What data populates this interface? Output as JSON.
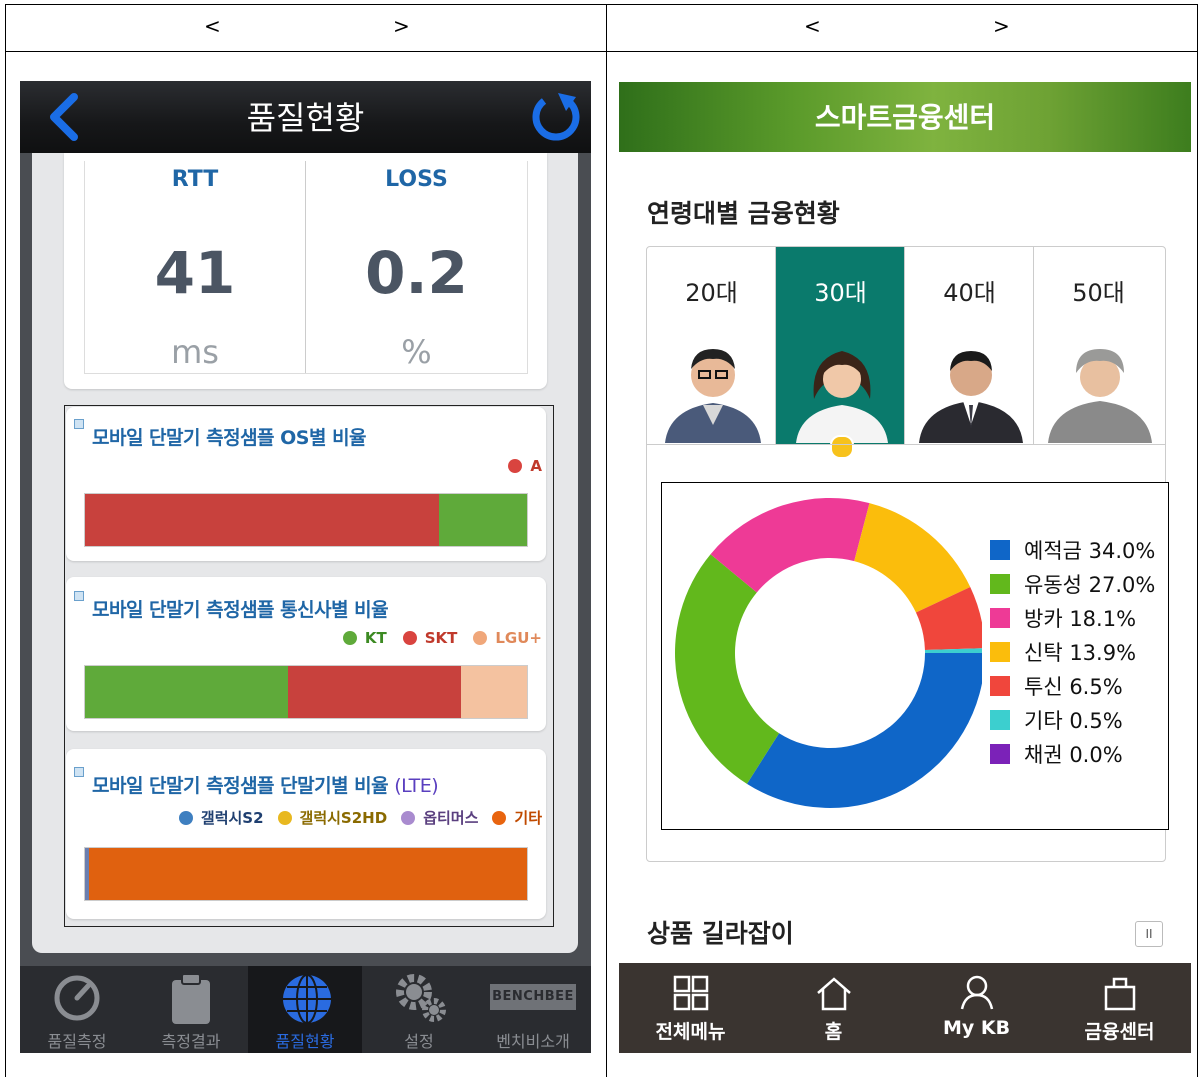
{
  "header": {
    "left": {
      "open": "<",
      "close": ">"
    },
    "right": {
      "open": "<",
      "close": ">"
    }
  },
  "left_app": {
    "title": "품질현황",
    "stats": [
      {
        "label": "RTT",
        "value": "41",
        "unit": "ms"
      },
      {
        "label": "LOSS",
        "value": "0.2",
        "unit": "%"
      }
    ],
    "sections": [
      {
        "title": "모바일 단말기 측정샘플 OS별 비율",
        "legend": [
          {
            "label": "A",
            "color": "#d9443f"
          }
        ],
        "bar": [
          {
            "fraction": 0.8,
            "color": "#c8413d"
          },
          {
            "fraction": 0.2,
            "color": "#5faa3a"
          }
        ]
      },
      {
        "title": "모바일 단말기 측정샘플 통신사별 비율",
        "legend": [
          {
            "label": "KT",
            "color": "#5faa3a"
          },
          {
            "label": "SKT",
            "color": "#d9443f"
          },
          {
            "label": "LGU+",
            "color": "#f0a77a"
          }
        ],
        "bar": [
          {
            "fraction": 0.46,
            "color": "#5faa3a"
          },
          {
            "fraction": 0.39,
            "color": "#c8413d"
          },
          {
            "fraction": 0.15,
            "color": "#f4c2a0"
          }
        ]
      },
      {
        "title": "모바일 단말기 측정샘플 단말기별 비율",
        "title_suffix": "(LTE)",
        "legend": [
          {
            "label": "갤럭시S2",
            "color": "#3e7fc0"
          },
          {
            "label": "갤럭시S2HD",
            "color": "#e8b820"
          },
          {
            "label": "옵티머스",
            "color": "#a98bcf"
          },
          {
            "label": "기타",
            "color": "#e8640f"
          }
        ],
        "bar": [
          {
            "fraction": 0.01,
            "color": "#6b7fb0"
          },
          {
            "fraction": 0.99,
            "color": "#e0610f"
          }
        ]
      }
    ],
    "tabs": [
      {
        "label": "품질측정",
        "icon": "gauge-icon",
        "active": false
      },
      {
        "label": "측정결과",
        "icon": "clipboard-icon",
        "active": false
      },
      {
        "label": "품질현황",
        "icon": "globe-icon",
        "active": true
      },
      {
        "label": "설정",
        "icon": "gear-icon",
        "active": false
      },
      {
        "label": "벤치비소개",
        "icon": "benchbee-logo-icon",
        "active": false
      }
    ],
    "logo_text": "BENCHBEE"
  },
  "right_app": {
    "title": "스마트금융센터",
    "heading": "연령대별 금융현황",
    "age_tabs": [
      {
        "label": "20대",
        "active": false
      },
      {
        "label": "30대",
        "active": true
      },
      {
        "label": "40대",
        "active": false
      },
      {
        "label": "50대",
        "active": false
      }
    ],
    "chart_data": {
      "type": "pie",
      "categories": [
        "예적금",
        "유동성",
        "방카",
        "신탁",
        "투신",
        "기타",
        "채권"
      ],
      "values": [
        34.0,
        27.0,
        18.1,
        13.9,
        6.5,
        0.5,
        0.0
      ],
      "legend_labels": [
        "예적금 34.0%",
        "유동성 27.0%",
        "방카 18.1%",
        "신탁 13.9%",
        "투신 6.5%",
        "기타 0.5%",
        "채권 0.0%"
      ],
      "colors": [
        "#0f66c8",
        "#62b81c",
        "#ee3a96",
        "#fbbd0c",
        "#f0463c",
        "#3ccfcf",
        "#7b22b8"
      ],
      "donut": true,
      "legend_position": "right"
    },
    "section2": "상품 길라잡이",
    "pause_label": "II",
    "tabs": [
      {
        "label": "전체메뉴",
        "icon": "grid-menu-icon"
      },
      {
        "label": "홈",
        "icon": "home-icon"
      },
      {
        "label": "My KB",
        "icon": "person-icon"
      },
      {
        "label": "금융센터",
        "icon": "bag-icon"
      }
    ]
  }
}
